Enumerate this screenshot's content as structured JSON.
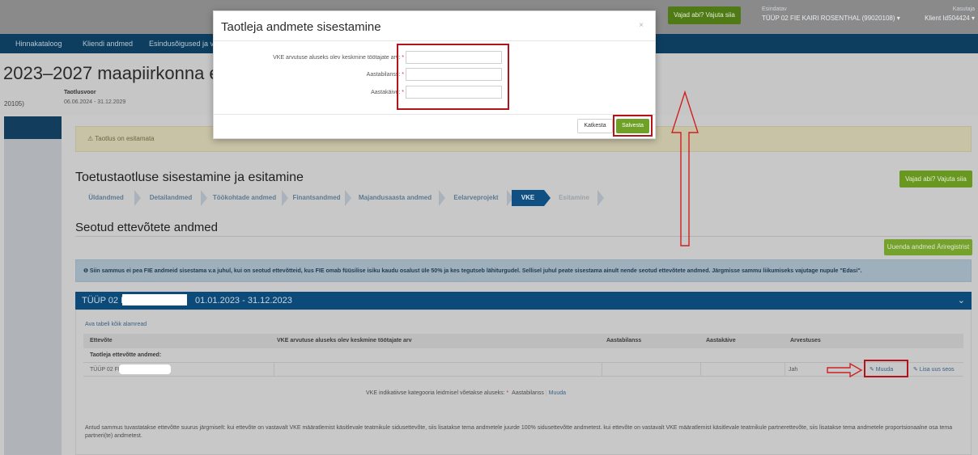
{
  "topbar": {
    "help_label": "Vajad abi? Vajuta siia",
    "representative_label": "Esindatav",
    "representative_value": "TÜÜP 02 FIE KAIRI ROSENTHAL (99020108) ▾",
    "user_label": "Kasutaja",
    "user_value": "Klient Id504424 ▾"
  },
  "navbar": {
    "items": [
      "Hinnakataloog",
      "Kliendi andmed",
      "Esindusõigused ja v"
    ]
  },
  "header": {
    "title": "2023–2027 maapiirkonna ettevõ",
    "id_trail": "20105)",
    "period_label": "Taotlusvoor",
    "period_value": "06.06.2024 - 31.12.2029"
  },
  "warning": "⚠ Taotlus on esitamata",
  "section": {
    "title": "Toetustaotluse sisestamine ja esitamine",
    "help_label": "Vajad abi? Vajuta siia"
  },
  "steps": [
    {
      "label": "Üldandmed"
    },
    {
      "label": "Detailandmed"
    },
    {
      "label": "Töökohtade andmed"
    },
    {
      "label": "Finantsandmed"
    },
    {
      "label": "Majandusaasta andmed"
    },
    {
      "label": "Eelarveprojekt"
    },
    {
      "label": "VKE"
    },
    {
      "label": "Esitamine"
    }
  ],
  "linked": {
    "title": "Seotud ettevõtete andmed",
    "register_button": "Uuenda andmed Äriregistrist",
    "info": "❶ Siin sammus ei pea FIE andmeid sisestama v.a juhul, kui on seotud ettevõtteid, kus FIE omab füüsilise isiku kaudu osalust üle 50% ja kes tegutseb lähiturgudel. Sellisel juhul peate sisestama ainult nende seotud ettevõtete andmed. Järgmisse sammu liikumiseks vajutage nupule \"Edasi\"."
  },
  "panel": {
    "title_prefix": "TÜÜP 02 FIE",
    "title_suffix": "01.01.2023 - 31.12.2023",
    "rows_link": "Ava tabeli kõik alamread",
    "columns": [
      "Ettevõte",
      "VKE arvutuse aluseks olev keskmine töötajate arv",
      "Aastabilanss",
      "Aastakäive",
      "Arvestuses"
    ],
    "group_label": "Taotleja ettevõtte andmed:",
    "row": {
      "company": "TÜÜP 02 FIE",
      "counted": "Jah"
    },
    "edit_action": "✎ Muuda",
    "add_action": "✎ Lisa uus seos"
  },
  "vke": {
    "label": "VKE indikatiivse kategooria leidmisel võetakse aluseks:",
    "required": "*",
    "value": "Aastabilanss",
    "separator": "|",
    "change": "Muuda"
  },
  "footer_text": "Antud sammus tuvastatakse ettevõtte suurus järgmiselt: kui ettevõte on vastavalt VKE määratlemist käsitlevale teatmikule sidusettevõte, siis lisatakse tema andmetele juurde 100% sidusettevõtte andmetest. kui ettevõte on vastavalt VKE määratlemist käsitlevale teatmikule partnerettevõte, siis lisatakse tema andmetele proportsionaalne osa tema partneri(te) andmetest.",
  "modal": {
    "title": "Taotleja andmete sisestamine",
    "close": "×",
    "fields": [
      {
        "label": "VKE arvutuse aluseks olev keskmine töötajate arv:",
        "required": "*",
        "value": ""
      },
      {
        "label": "Aastabilanss:",
        "required": "*",
        "value": ""
      },
      {
        "label": "Aastakäive:",
        "required": "*",
        "value": ""
      }
    ],
    "cancel": "Katkesta",
    "save": "Salvesta"
  },
  "colors": {
    "nav": "#0d3e60",
    "active_step": "#0f4f82",
    "save": "#6ea126",
    "annotation": "#b3141a"
  }
}
